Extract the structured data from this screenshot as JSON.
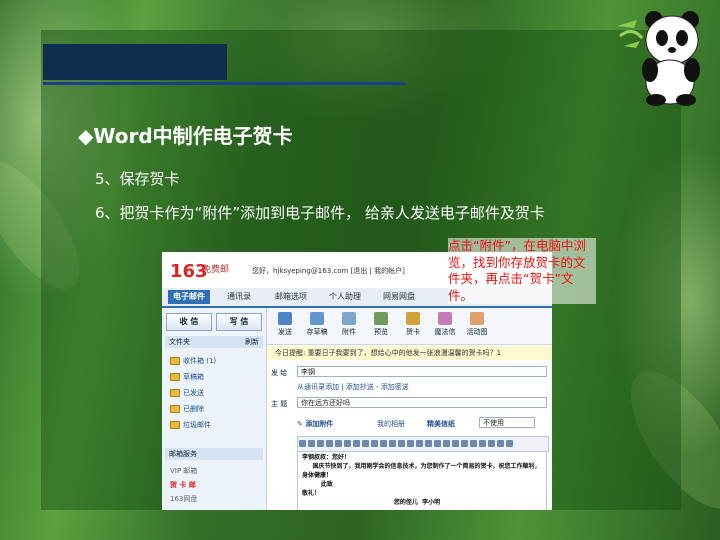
{
  "heading": "◆Word中制作电子贺卡",
  "steps": [
    "5、保存贺卡",
    "6、把贺卡作为“附件”添加到电子邮件， 给亲人发送电子邮件及贺卡"
  ],
  "annotation": "点击“附件”，在电脑中浏览，找到你存放贺卡的文件夹，再点击“贺卡”文件。",
  "mail": {
    "logo": "163",
    "logo_sub": "免费邮",
    "account": "您好，hjksyeping@163.com [退出 | 我的帐户]",
    "tabs": [
      "电子邮件",
      "通讯录",
      "邮箱选项",
      "个人助理",
      "网易网盘"
    ],
    "btn_receive": "收 信",
    "btn_write": "写 信",
    "folder_title": "文件夹",
    "folder_refresh": "刷新",
    "folders": [
      "收件箱 (1)",
      "草稿箱",
      "已发送",
      "已删除",
      "垃圾邮件"
    ],
    "service_title": "邮箱服务",
    "services": [
      "VIP 邮箱",
      "贺 卡 邮",
      "163网盘"
    ],
    "tools": [
      "发送",
      "存草稿",
      "附件",
      "预览",
      "贺卡",
      "魔法信",
      "活动图"
    ],
    "notice": "今日提醒: 重要日子我要到了，想给心中的他发一张浪漫温馨的贺卡吗？1",
    "to_label": "发 给",
    "to_value": "李钢",
    "from_hint": "从通讯录添加 | 添加抄送 - 添加密送",
    "subject_label": "主 题",
    "subject_value": "你在远方还好吗",
    "attach": "添加附件",
    "album": "我的相册",
    "stationery": "精美信纸",
    "stationery_value": "不使用",
    "body": "李钢叔叔：您好！\n     国庆节快到了，我用刚学会的信息技术，为您制作了一个简易的贺卡，祝您工作顺利，身体健康！\n         此致\n敬礼！\n                                            您的侄儿  李小明"
  },
  "colors": {
    "annotation": "#ee1111",
    "title_bar": "#0e2d4f",
    "mail_blue": "#2f6fb5"
  }
}
